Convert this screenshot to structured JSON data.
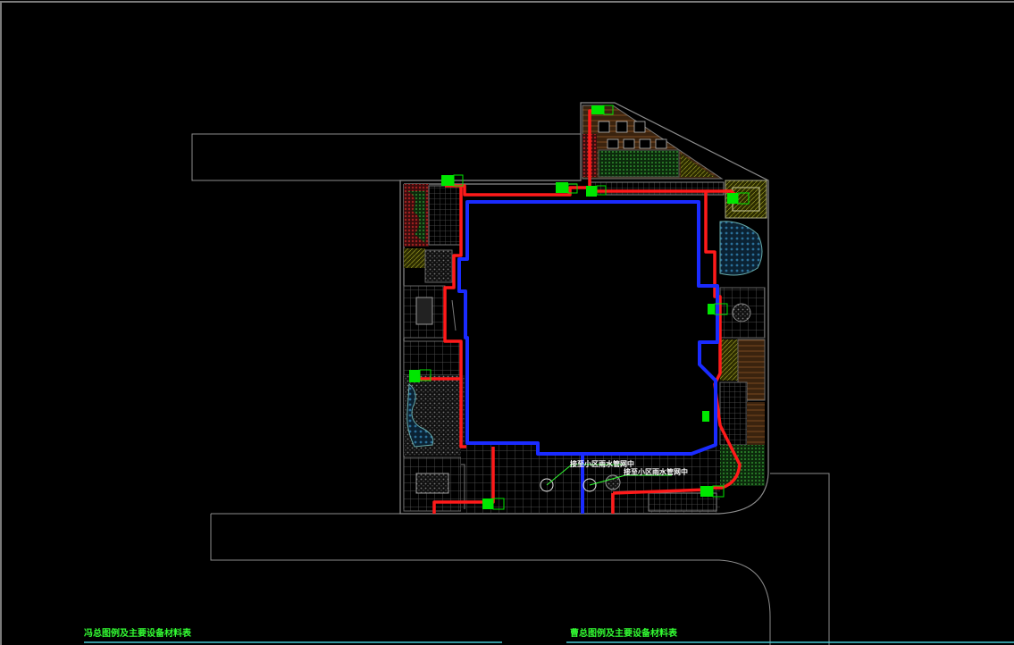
{
  "drawing": {
    "background_color": "#000000",
    "colors": {
      "outline": "#8c8c8c",
      "outline_dim": "#5a5a5a",
      "supply_pipe": "#ff1a1a",
      "drain_pipe": "#1a2bff",
      "equipment": "#00e600",
      "paving": "#3c3c3c",
      "planting_green": "#1f5c1f",
      "planting_red": "#8a1d1d",
      "water": "#1b4f73",
      "timber": "#6b3f1c",
      "label_white": "#ffffff",
      "label_green": "#33ff33",
      "underline_cyan": "#46c8d2"
    }
  },
  "annotations": {
    "outlet_1": "接至小区雨水管网中",
    "outlet_2": "接至小区雨水管网中"
  },
  "tables": {
    "left_title": "冯总图例及主要设备材料表",
    "right_title": "曹总图例及主要设备材料表"
  }
}
